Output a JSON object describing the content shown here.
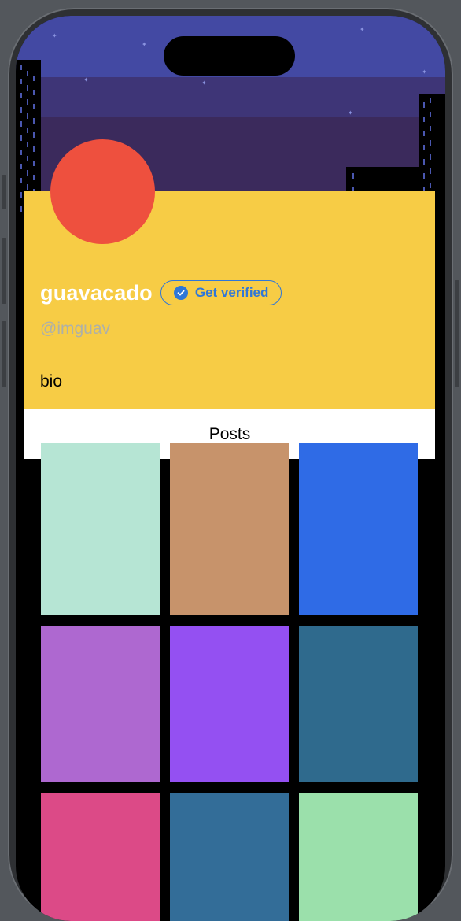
{
  "profile": {
    "display_name": "guavacado",
    "verify_label": "Get verified",
    "handle": "@imguav",
    "bio": "bio",
    "avatar_color": "#ee503e",
    "card_color": "#f7cc45",
    "accent_color": "#2f77d8"
  },
  "tabs": {
    "posts_label": "Posts"
  },
  "header_colors": [
    "#4349a3",
    "#3e3577",
    "#3b2a5c"
  ],
  "posts": [
    {
      "color": "#b6e5d4"
    },
    {
      "color": "#c7936b"
    },
    {
      "color": "#2f6be6"
    },
    {
      "color": "#ae68d0"
    },
    {
      "color": "#9450f2"
    },
    {
      "color": "#2f6a8d"
    },
    {
      "color": "#dc4a87"
    },
    {
      "color": "#336d98"
    },
    {
      "color": "#9be0ab"
    }
  ]
}
